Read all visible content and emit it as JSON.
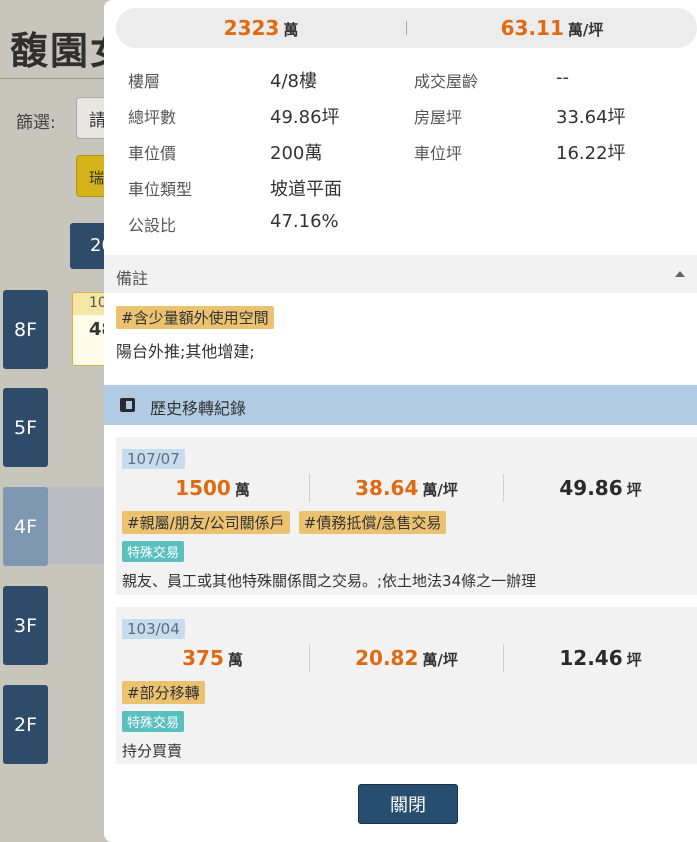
{
  "background": {
    "page_title": "馥園女",
    "filter_label": "篩選:",
    "filter_value": "請",
    "yellow_button": "瑞",
    "year_button": "20",
    "unit_card_top": "10",
    "unit_card_num": "48",
    "floors": [
      "8F",
      "5F",
      "4F",
      "3F",
      "2F"
    ]
  },
  "summary": {
    "price": "2323",
    "price_unit": "萬",
    "unit_price": "63.11",
    "unit_price_unit": "萬/坪"
  },
  "details": {
    "floor_label": "樓層",
    "floor_value": "4/8樓",
    "age_label": "成交屋齡",
    "age_value": "--",
    "total_area_label": "總坪數",
    "total_area_value": "49.86坪",
    "house_area_label": "房屋坪",
    "house_area_value": "33.64坪",
    "parking_price_label": "車位價",
    "parking_price_value": "200萬",
    "parking_area_label": "車位坪",
    "parking_area_value": "16.22坪",
    "parking_type_label": "車位類型",
    "parking_type_value": "坡道平面",
    "public_ratio_label": "公設比",
    "public_ratio_value": "47.16%"
  },
  "remark": {
    "header": "備註",
    "tag": "#含少量額外使用空間",
    "text": "陽台外推;其他增建;"
  },
  "history": {
    "header": "歷史移轉紀錄",
    "records": [
      {
        "date": "107/07",
        "price": "1500",
        "price_unit": "萬",
        "unit_price": "38.64",
        "unit_price_unit": "萬/坪",
        "area": "49.86",
        "area_unit": "坪",
        "tags": [
          "#親屬/朋友/公司關係戶",
          "#債務抵償/急售交易"
        ],
        "special": "特殊交易",
        "note": "親友、員工或其他特殊關係間之交易。;依土地法34條之一辦理"
      },
      {
        "date": "103/04",
        "price": "375",
        "price_unit": "萬",
        "unit_price": "20.82",
        "unit_price_unit": "萬/坪",
        "area": "12.46",
        "area_unit": "坪",
        "tags": [
          "#部分移轉"
        ],
        "special": "特殊交易",
        "note": "持分買賣"
      }
    ]
  },
  "close_label": "關閉",
  "colors": {
    "accent_orange": "#e06a12",
    "navy": "#274d70",
    "tag_yellow": "#ebc270",
    "tag_teal": "#59bfbf",
    "history_blue": "#b0cbe3"
  }
}
